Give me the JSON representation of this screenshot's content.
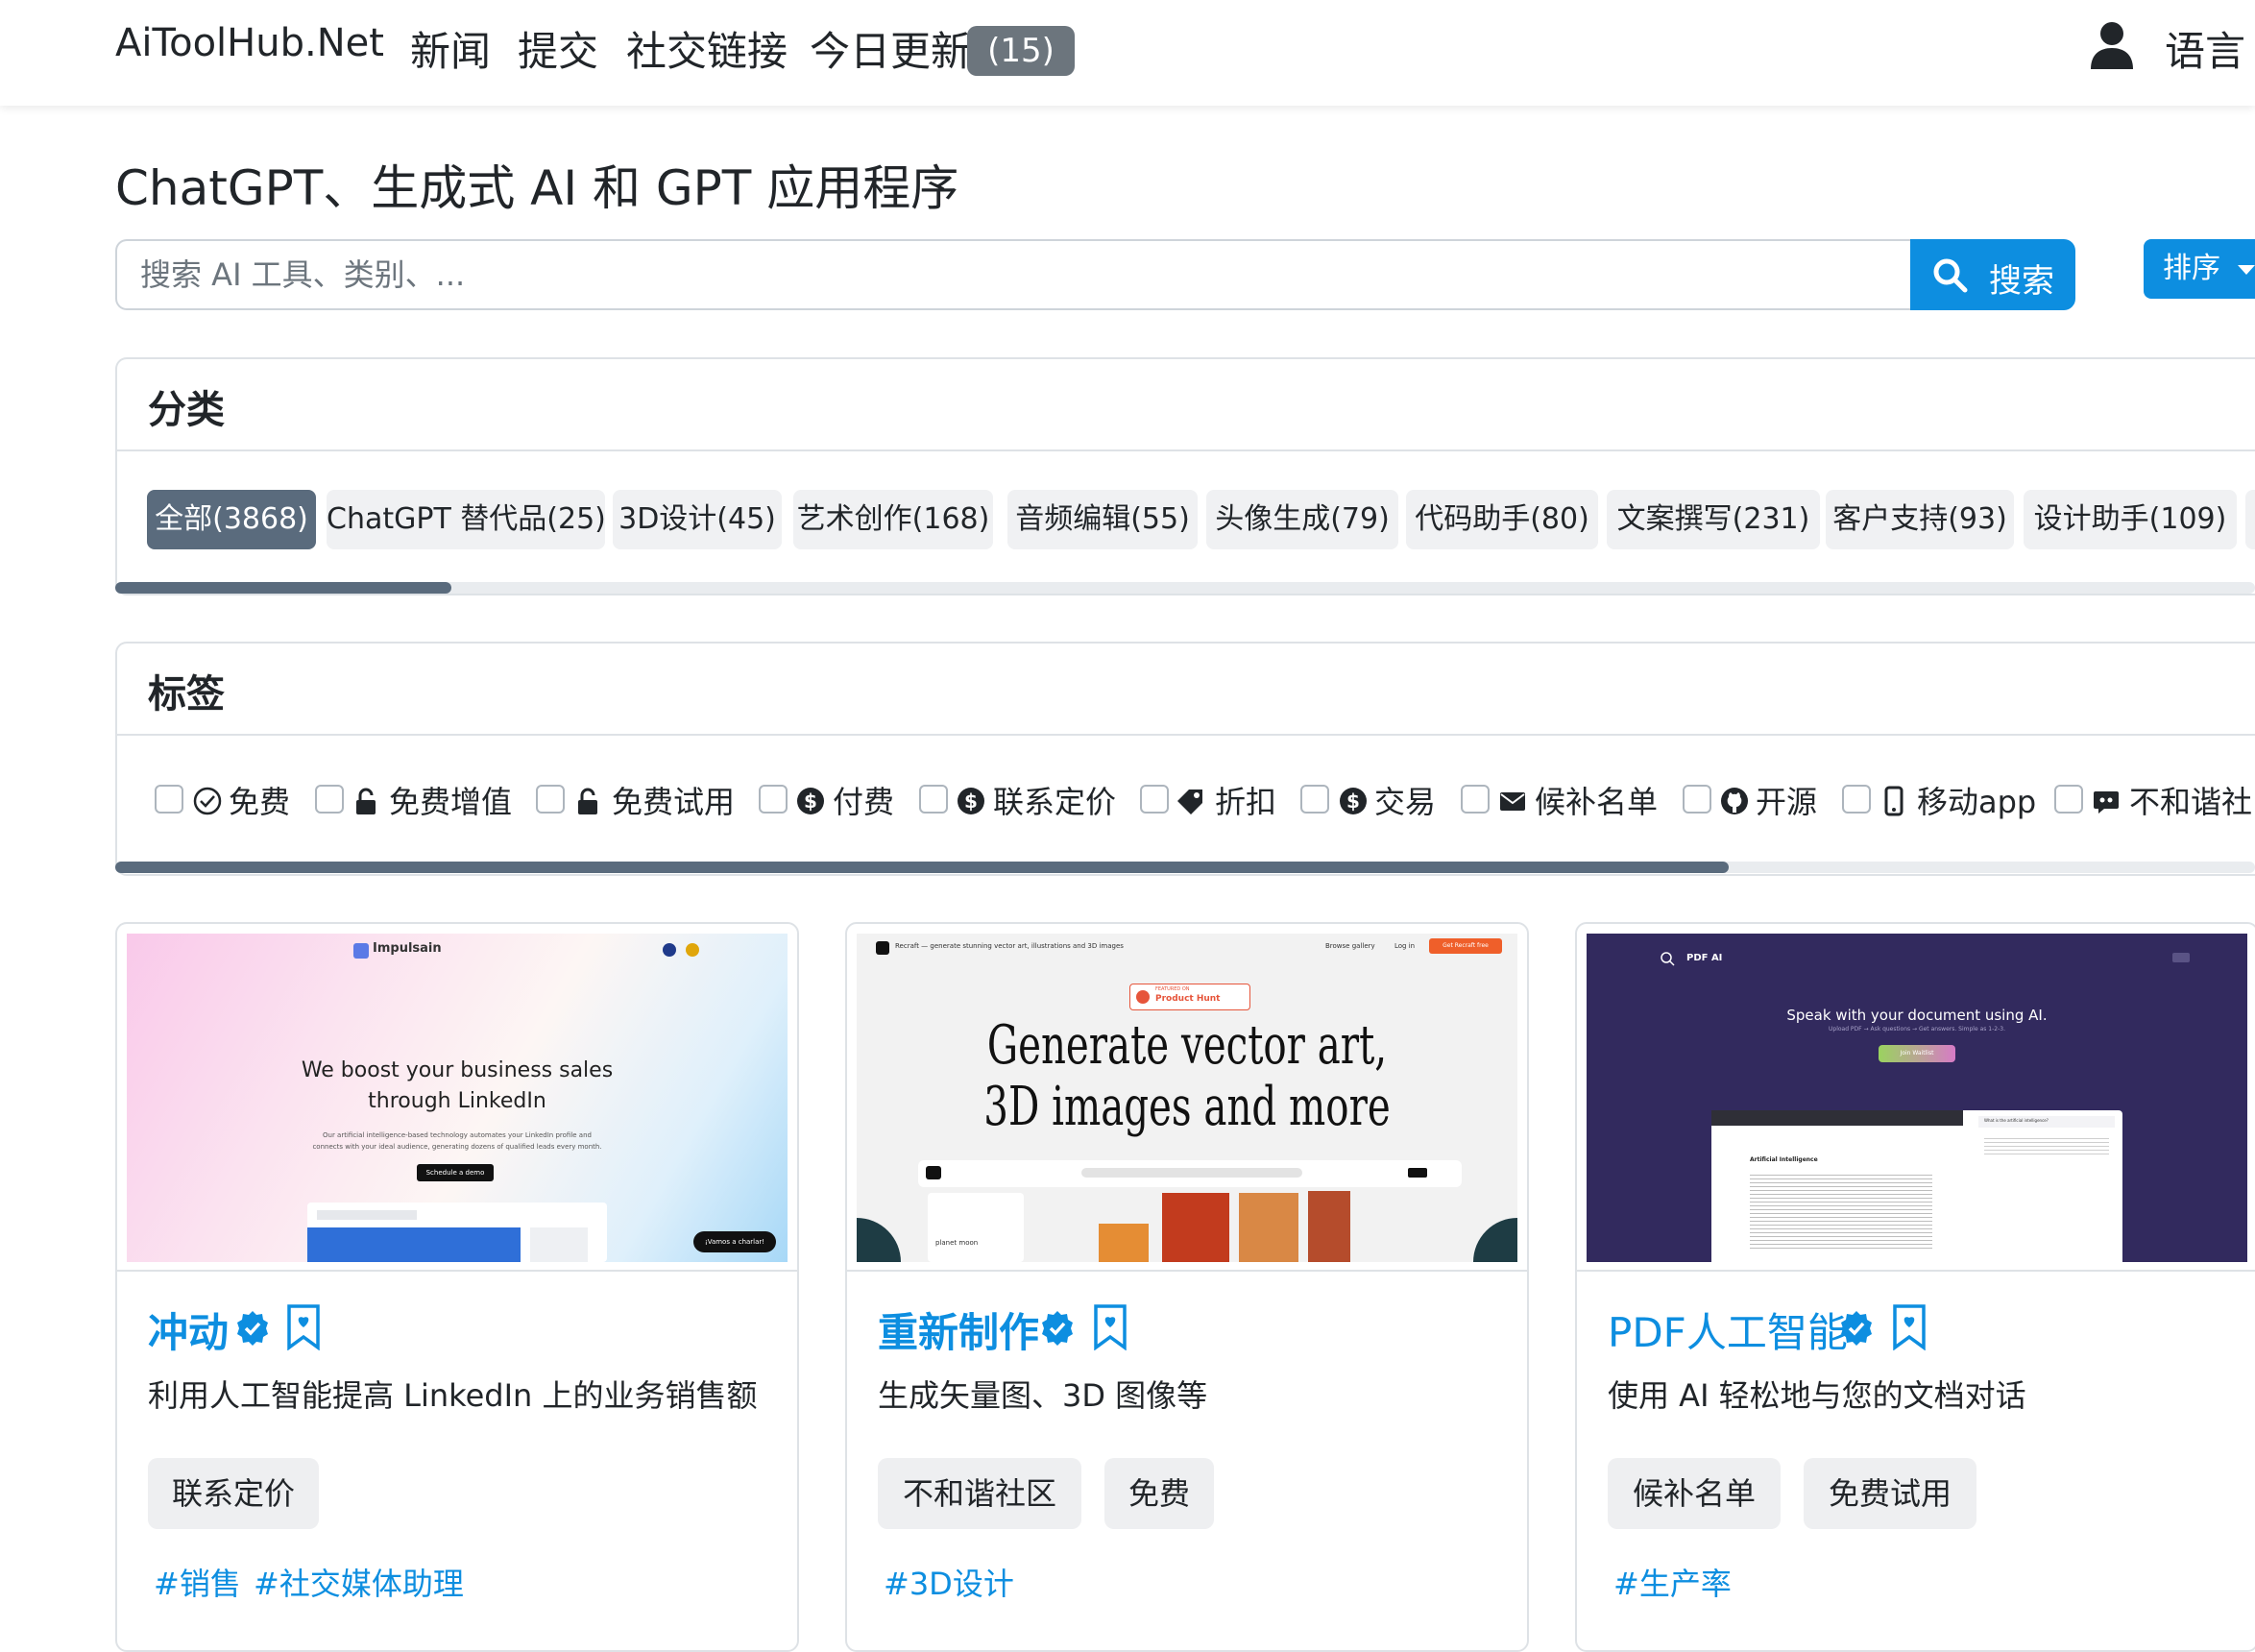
{
  "navbar": {
    "brand": "AiToolHub.Net",
    "links": [
      "新闻",
      "提交",
      "社交链接",
      "今日更新"
    ],
    "updates_badge": "(15)",
    "language": "语言",
    "user_icon": "user-icon"
  },
  "page": {
    "title": "ChatGPT、生成式 AI 和 GPT 应用程序"
  },
  "search": {
    "placeholder": "搜索 AI 工具、类别、...",
    "button_label": "搜索",
    "sort_label": "排序"
  },
  "categories": {
    "title": "分类",
    "items": [
      {
        "label": "全部(3868)",
        "active": true
      },
      {
        "label": "ChatGPT 替代品(25)"
      },
      {
        "label": "3D设计(45)"
      },
      {
        "label": "艺术创作(168)"
      },
      {
        "label": "音频编辑(55)"
      },
      {
        "label": "头像生成(79)"
      },
      {
        "label": "代码助手(80)"
      },
      {
        "label": "文案撰写(231)"
      },
      {
        "label": "客户支持(93)"
      },
      {
        "label": "设计助手(109)"
      }
    ]
  },
  "tags": {
    "title": "标签",
    "items": [
      {
        "label": "免费",
        "icon": "check-circle-icon"
      },
      {
        "label": "免费增值",
        "icon": "unlock-icon"
      },
      {
        "label": "免费试用",
        "icon": "unlock-icon"
      },
      {
        "label": "付费",
        "icon": "dollar-circle-icon"
      },
      {
        "label": "联系定价",
        "icon": "dollar-circle-icon"
      },
      {
        "label": "折扣",
        "icon": "tag-icon"
      },
      {
        "label": "交易",
        "icon": "dollar-circle-icon"
      },
      {
        "label": "候补名单",
        "icon": "envelope-icon"
      },
      {
        "label": "开源",
        "icon": "github-icon"
      },
      {
        "label": "移动app",
        "icon": "mobile-icon"
      },
      {
        "label": "不和谐社",
        "icon": "discord-icon"
      }
    ]
  },
  "tools": [
    {
      "name": "冲动",
      "description": "利用人工智能提高 LinkedIn 上的业务销售额",
      "pricing": [
        "联系定价"
      ],
      "hashtags": [
        "#销售",
        "#社交媒体助理"
      ],
      "screenshot": {
        "logo": "Impulsain",
        "headline_1": "We boost your business sales",
        "headline_2": "through LinkedIn",
        "sub_1": "Our artificial intelligence-based technology automates your LinkedIn profile and",
        "sub_2": "connects with your ideal audience, generating dozens of qualified leads every month.",
        "cta": "Schedule a demo",
        "chat": "¡Vamos a charlar!"
      }
    },
    {
      "name": "重新制作",
      "description": "生成矢量图、3D 图像等",
      "pricing": [
        "不和谐社区",
        "免费"
      ],
      "hashtags": [
        "#3D设计"
      ],
      "screenshot": {
        "top": "Recraft — generate stunning vector art, illustrations and 3D images",
        "nav_1": "Browse gallery",
        "nav_2": "Log in",
        "cta": "Get Recraft free",
        "badge_1": "FEATURED ON",
        "badge_2": "Product Hunt",
        "headline_1": "Generate vector art,",
        "headline_2": "3D images and more",
        "caption": "planet moon"
      }
    },
    {
      "name": "PDF人工智能",
      "description": "使用 AI 轻松地与您的文档对话",
      "pricing": [
        "候补名单",
        "免费试用"
      ],
      "hashtags": [
        "#生产率"
      ],
      "screenshot": {
        "logo": "PDF AI",
        "headline": "Speak with your document using AI.",
        "sub": "Upload PDF → Ask questions → Get answers. Simple as 1-2-3.",
        "cta": "Join Waitlist",
        "doc_title": "Artificial Intelligence",
        "chat_q": "What is the artificial intelligence?"
      }
    }
  ],
  "colors": {
    "accent": "#0d8ee0",
    "active_pill": "#5a6b7d",
    "badge": "#6c757d",
    "pill_bg": "#f0f1f3"
  }
}
